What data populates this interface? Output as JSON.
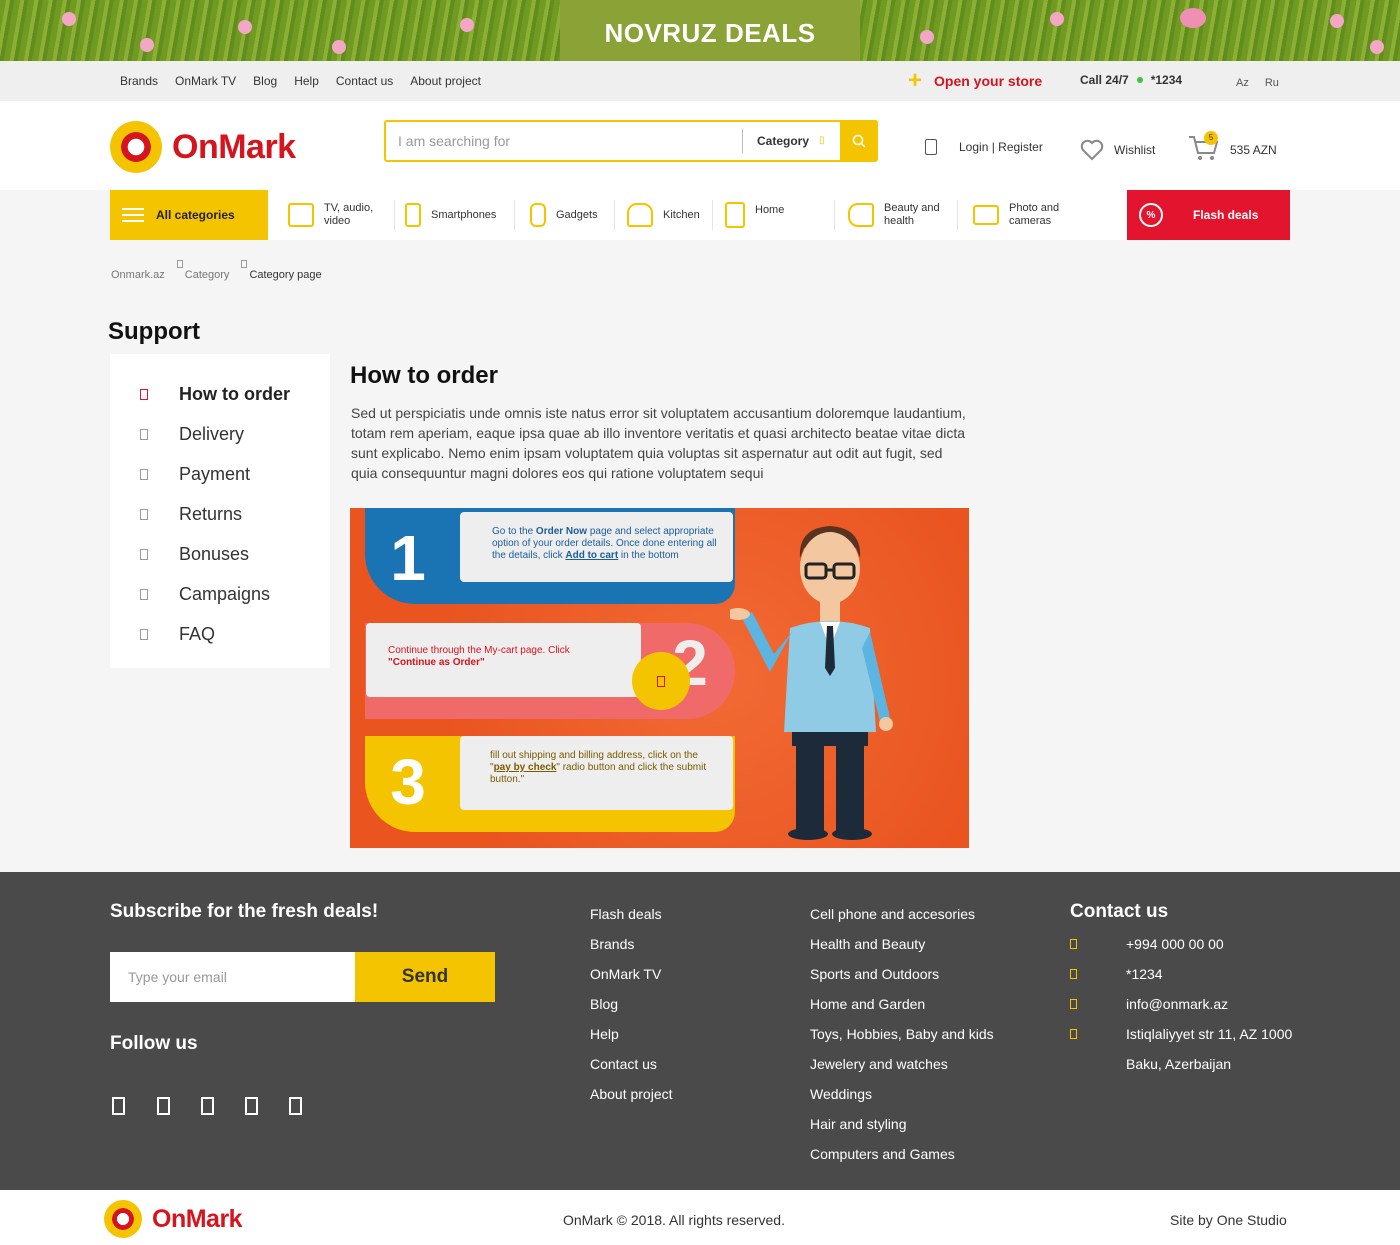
{
  "banner": {
    "title": "NOVRUZ DEALS"
  },
  "topbar": {
    "links": [
      "Brands",
      "OnMark TV",
      "Blog",
      "Help",
      "Contact us",
      "About project"
    ],
    "open_store": "Open your store",
    "call_label": "Call 24/7",
    "call_number": "*1234",
    "langs": [
      "Az",
      "Ru"
    ]
  },
  "header": {
    "logo": "OnMark",
    "search_placeholder": "I am searching for",
    "category_label": "Category",
    "login": "Login | Register",
    "wishlist": "Wishlist",
    "cart_count": "5",
    "cart_total": "535 AZN"
  },
  "nav": {
    "all_categories": "All categories",
    "items": [
      {
        "label": "TV, audio, video",
        "icon": "tv-icon"
      },
      {
        "label": "Smartphones",
        "icon": "smartphone-icon"
      },
      {
        "label": "Gadgets",
        "icon": "smartwatch-icon"
      },
      {
        "label": "Kitchen",
        "icon": "kettle-icon"
      },
      {
        "label": "Home",
        "icon": "washing-machine-icon"
      },
      {
        "label": "Beauty and health",
        "icon": "hair-dryer-icon"
      },
      {
        "label": "Photo and cameras",
        "icon": "camera-icon"
      }
    ],
    "flash_deals": "Flash deals"
  },
  "breadcrumb": [
    "Onmark.az",
    "Category",
    "Category page"
  ],
  "support": {
    "title": "Support",
    "menu": [
      "How to order",
      "Delivery",
      "Payment",
      "Returns",
      "Bonuses",
      "Campaigns",
      "FAQ"
    ],
    "active_index": 0
  },
  "content": {
    "title": "How to order",
    "text": "Sed ut perspiciatis unde omnis iste natus error sit voluptatem accusantium doloremque laudantium, totam rem aperiam, eaque ipsa quae ab illo inventore veritatis et quasi architecto beatae vitae dicta sunt explicabo. Nemo enim ipsam voluptatem quia voluptas sit aspernatur aut odit aut fugit, sed quia consequuntur magni dolores eos qui ratione voluptatem sequi"
  },
  "infographic": {
    "steps": [
      {
        "number": "1",
        "text_a": "Go to the ",
        "bold_a": "Order Now",
        "text_b": " page and select appropriate option of your order details. Once done entering all the details, click ",
        "bold_b": "Add to cart",
        "text_c": " in the bottom"
      },
      {
        "number": "2",
        "text_a": "Continue through the My-cart page. Click ",
        "bold_a": "\"Continue as Order\"",
        "text_b": "",
        "bold_b": "",
        "text_c": ""
      },
      {
        "number": "3",
        "text_a": "fill out shipping and billing address, click on the \"",
        "bold_a": "pay by check",
        "text_b": "\" radio button and click the submit button.\"",
        "bold_b": "",
        "text_c": ""
      }
    ]
  },
  "footer": {
    "subscribe_title": "Subscribe for the fresh deals!",
    "email_placeholder": "Type your email",
    "send": "Send",
    "follow": "Follow us",
    "social_icons": [
      "facebook-icon",
      "instagram-icon",
      "twitter-icon",
      "youtube-icon",
      "linkedin-icon"
    ],
    "col1": [
      "Flash deals",
      "Brands",
      "OnMark TV",
      "Blog",
      "Help",
      "Contact us",
      "About project"
    ],
    "col2": [
      "Cell phone and accesories",
      "Health and Beauty",
      "Sports and Outdoors",
      "Home and Garden",
      "Toys, Hobbies, Baby and kids",
      "Jewelery and watches",
      "Weddings",
      "Hair and styling",
      "Computers and Games"
    ],
    "contact_title": "Contact us",
    "contacts": [
      {
        "icon": "phone-icon",
        "text": "+994 000 00 00"
      },
      {
        "icon": "headset-icon",
        "text": "*1234"
      },
      {
        "icon": "mail-icon",
        "text": "info@onmark.az"
      },
      {
        "icon": "location-icon",
        "text": "Istiqlaliyyet str 11, AZ 1000"
      }
    ],
    "address_line2": "Baku, Azerbaijan",
    "copyright": "OnMark © 2018. All rights reserved.",
    "site_by": "Site by One Studio"
  },
  "colors": {
    "brand_red": "#d6141e",
    "brand_yellow": "#f5c400",
    "footer_bg": "#4a4a4a",
    "flash_red": "#e3142e"
  }
}
